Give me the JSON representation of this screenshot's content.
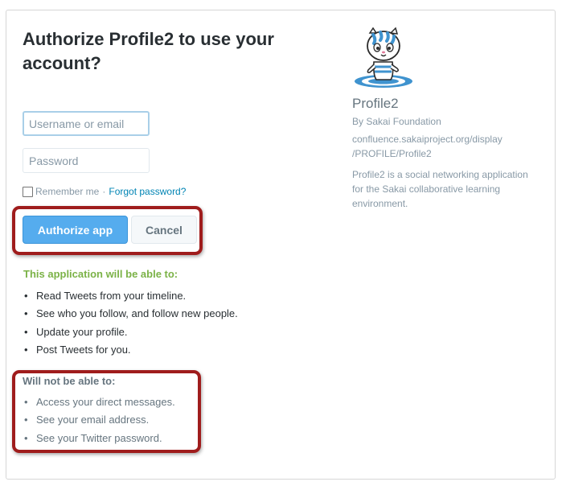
{
  "page": {
    "title": "Authorize Profile2 to use your account?"
  },
  "form": {
    "username_placeholder": "Username or email",
    "password_placeholder": "Password",
    "remember_label": "Remember me",
    "separator": "·",
    "forgot_link": "Forgot password?"
  },
  "buttons": {
    "authorize_label": "Authorize app",
    "cancel_label": "Cancel"
  },
  "permissions": {
    "can_heading": "This application will be able to:",
    "can": [
      "Read Tweets from your timeline.",
      "See who you follow, and follow new people.",
      "Update your profile.",
      "Post Tweets for you."
    ],
    "cannot_heading": "Will not be able to:",
    "cannot": [
      "Access your direct messages.",
      "See your email address.",
      "See your Twitter password."
    ]
  },
  "app": {
    "name": "Profile2",
    "by": "By Sakai Foundation",
    "url_line1": "confluence.sakaiproject.org/display",
    "url_line2": "/PROFILE/Profile2",
    "description": "Profile2 is a social networking application for the Sakai collaborative learning environment.",
    "logo_icon": "cat-mascot-icon"
  },
  "colors": {
    "primary_button": "#55acee",
    "can_heading": "#7bb247",
    "link": "#0084b4",
    "highlight_annotation": "#9f1c1c"
  }
}
